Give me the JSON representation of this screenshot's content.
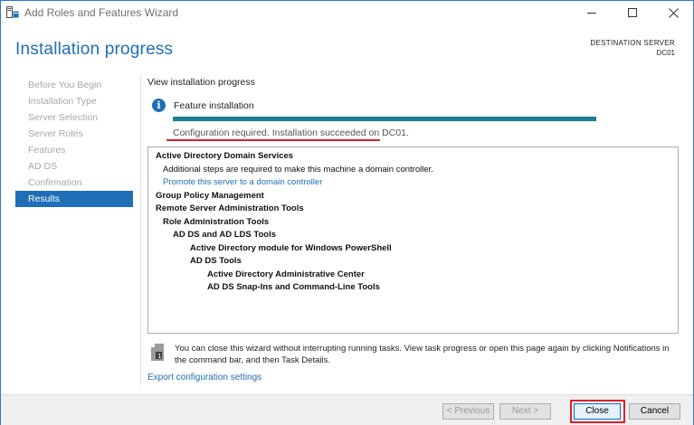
{
  "window": {
    "title": "Add Roles and Features Wizard",
    "controls": [
      "minimize",
      "maximize",
      "close"
    ]
  },
  "header": {
    "title": "Installation progress",
    "destination_label": "DESTINATION SERVER",
    "destination_value": "DC01"
  },
  "sidebar": {
    "items": [
      {
        "label": "Before You Begin",
        "active": false
      },
      {
        "label": "Installation Type",
        "active": false
      },
      {
        "label": "Server Selection",
        "active": false
      },
      {
        "label": "Server Roles",
        "active": false
      },
      {
        "label": "Features",
        "active": false
      },
      {
        "label": "AD DS",
        "active": false
      },
      {
        "label": "Confirmation",
        "active": false
      },
      {
        "label": "Results",
        "active": true
      }
    ]
  },
  "main": {
    "section_label": "View installation progress",
    "feature_label": "Feature installation",
    "progress_fraction": 1.0,
    "status_text": "Configuration required. Installation succeeded on DC01.",
    "results": [
      {
        "text": "Active Directory Domain Services",
        "level": 0,
        "bold": true
      },
      {
        "text": "Additional steps are required to make this machine a domain controller.",
        "level": 1,
        "bold": false
      },
      {
        "text": "Promote this server to a domain controller",
        "level": 1,
        "bold": false,
        "link": true
      },
      {
        "text": "Group Policy Management",
        "level": 0,
        "bold": true
      },
      {
        "text": "Remote Server Administration Tools",
        "level": 0,
        "bold": true
      },
      {
        "text": "Role Administration Tools",
        "level": 1,
        "bold": true
      },
      {
        "text": "AD DS and AD LDS Tools",
        "level": 2,
        "bold": true
      },
      {
        "text": "Active Directory module for Windows PowerShell",
        "level": 3,
        "bold": true
      },
      {
        "text": "AD DS Tools",
        "level": 3,
        "bold": true
      },
      {
        "text": "Active Directory Administrative Center",
        "level": 4,
        "bold": true
      },
      {
        "text": "AD DS Snap-Ins and Command-Line Tools",
        "level": 4,
        "bold": true
      }
    ],
    "note_text": "You can close this wizard without interrupting running tasks. View task progress or open this page again by clicking Notifications in the command bar, and then Task Details.",
    "export_link": "Export configuration settings"
  },
  "footer": {
    "previous_label": "< Previous",
    "next_label": "Next >",
    "close_label": "Close",
    "cancel_label": "Cancel"
  },
  "colors": {
    "accent": "#1e6fb8",
    "progress": "#1a7f8e",
    "highlight": "#e0202b"
  }
}
